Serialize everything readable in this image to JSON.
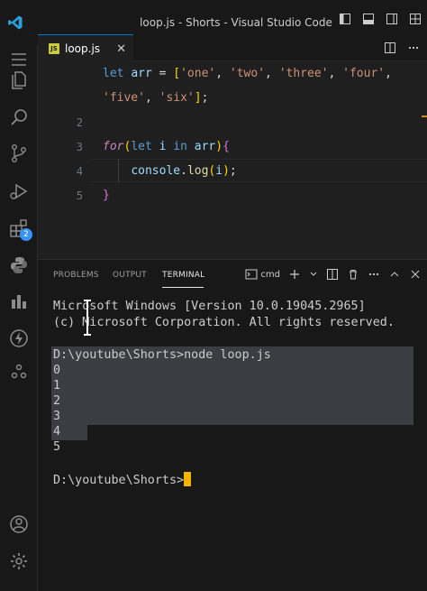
{
  "window": {
    "title": "loop.js - Shorts - Visual Studio Code"
  },
  "tab": {
    "filename": "loop.js",
    "icon_text": "JS",
    "close_glyph": "✕"
  },
  "editor": {
    "lines": [
      {
        "num": "",
        "tokens": [
          [
            "kw",
            "let"
          ],
          [
            "pun",
            " "
          ],
          [
            "var",
            "arr"
          ],
          [
            "pun",
            " = "
          ],
          [
            "br",
            "["
          ],
          [
            "str",
            "'one'"
          ],
          [
            "pun",
            ", "
          ],
          [
            "str",
            "'two'"
          ],
          [
            "pun",
            ", "
          ],
          [
            "str",
            "'three'"
          ],
          [
            "pun",
            ", "
          ],
          [
            "str",
            "'four'"
          ],
          [
            "pun",
            ","
          ]
        ]
      },
      {
        "num": "",
        "tokens": [
          [
            "str",
            "'five'"
          ],
          [
            "pun",
            ", "
          ],
          [
            "str",
            "'six'"
          ],
          [
            "br",
            "]"
          ],
          [
            "pun",
            ";"
          ]
        ]
      },
      {
        "num": "2",
        "tokens": []
      },
      {
        "num": "3",
        "tokens": [
          [
            "kw2",
            "for"
          ],
          [
            "br",
            "("
          ],
          [
            "kw",
            "let"
          ],
          [
            "pun",
            " "
          ],
          [
            "var",
            "i"
          ],
          [
            "pun",
            " "
          ],
          [
            "kw",
            "in"
          ],
          [
            "pun",
            " "
          ],
          [
            "var",
            "arr"
          ],
          [
            "br",
            ")"
          ],
          [
            "br2",
            "{"
          ]
        ]
      },
      {
        "num": "4",
        "tokens": [
          [
            "pun",
            "    "
          ],
          [
            "var",
            "console"
          ],
          [
            "pun",
            "."
          ],
          [
            "fn",
            "log"
          ],
          [
            "br",
            "("
          ],
          [
            "var",
            "i"
          ],
          [
            "br",
            ")"
          ],
          [
            "pun",
            ";"
          ]
        ]
      },
      {
        "num": "5",
        "tokens": [
          [
            "br2",
            "}"
          ]
        ]
      }
    ]
  },
  "panel": {
    "tabs": [
      "PROBLEMS",
      "OUTPUT",
      "TERMINAL"
    ],
    "active_tab": "TERMINAL",
    "shell_label": "cmd"
  },
  "terminal": {
    "lines": [
      "Microsoft Windows [Version 10.0.19045.2965]",
      "(c) Microsoft Corporation. All rights reserved.",
      "",
      "D:\\youtube\\Shorts>node loop.js",
      "0",
      "1",
      "2",
      "3",
      "4",
      "5",
      "",
      "D:\\youtube\\Shorts>"
    ]
  },
  "activity": {
    "extensions_badge": "2"
  },
  "colors": {
    "accent": "#0078d4",
    "cursor": "#f0b400",
    "badge": "#3794ff"
  },
  "icons": [
    "vscode-logo-icon",
    "files-icon",
    "search-icon",
    "source-control-icon",
    "run-debug-icon",
    "extensions-icon",
    "python-icon",
    "chart-icon",
    "thunder-icon",
    "remote-icon",
    "account-icon",
    "settings-gear-icon"
  ]
}
